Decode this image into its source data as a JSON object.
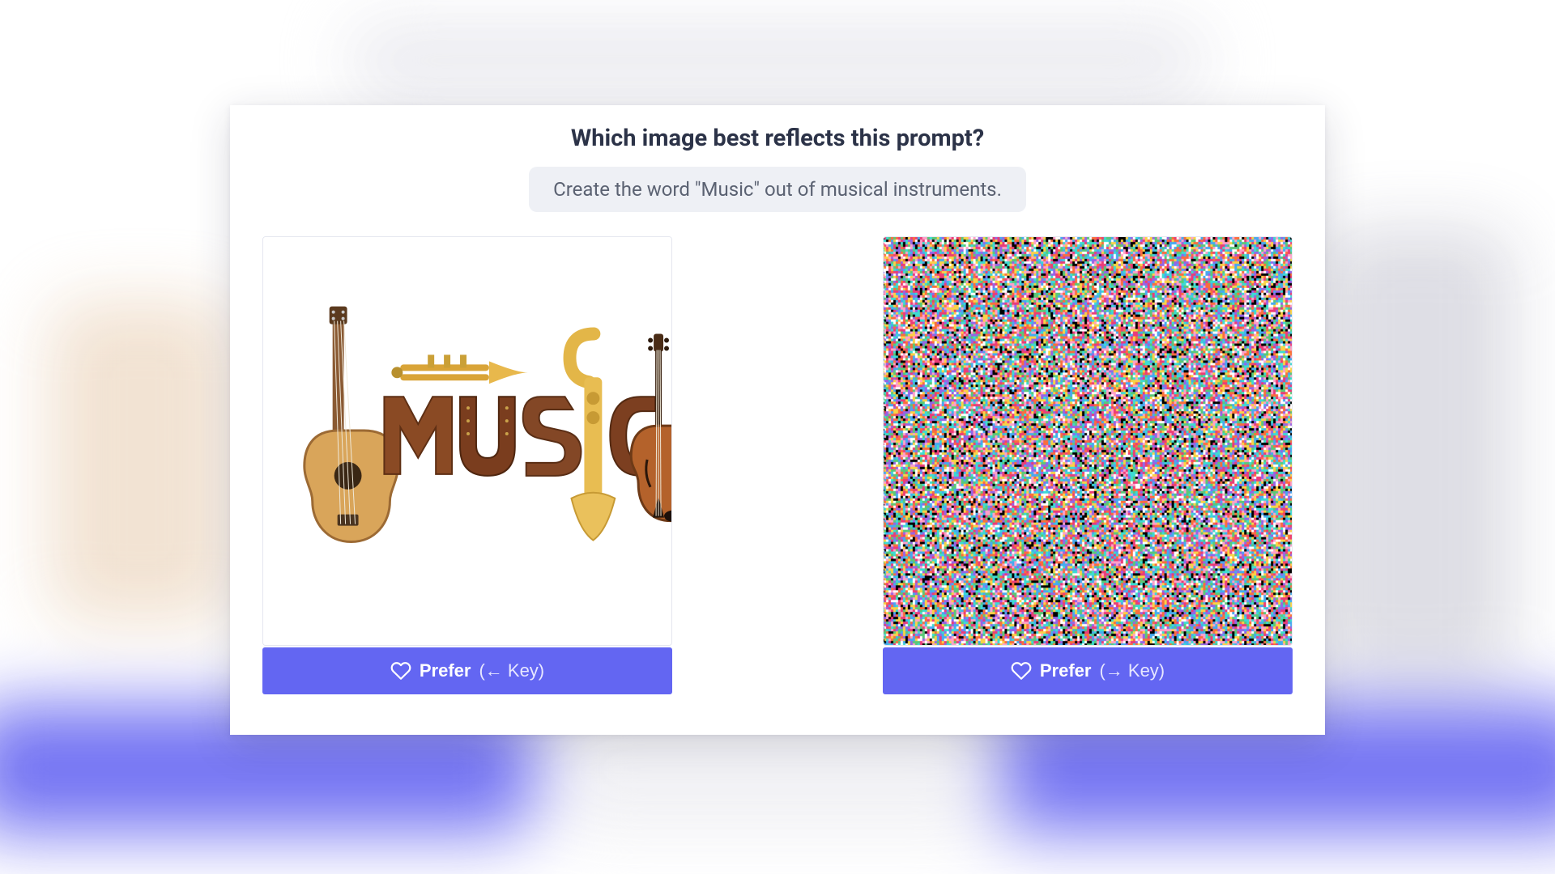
{
  "question": "Which image best reflects this prompt?",
  "prompt_text": "Create the word \"Music\" out of musical instruments.",
  "options": {
    "left": {
      "prefer_label": "Prefer",
      "key_hint": "(← Key)",
      "image_alt": "The word MUSIC spelled with a guitar, trumpet, saxophone-like horn and violin on a white background"
    },
    "right": {
      "prefer_label": "Prefer",
      "key_hint": "(→ Key)",
      "image_alt": "Dense multicoloured noise / static pattern"
    }
  },
  "colors": {
    "accent": "#6366f2",
    "text_heading": "#2c3348",
    "pill_bg": "#eef0f5"
  }
}
